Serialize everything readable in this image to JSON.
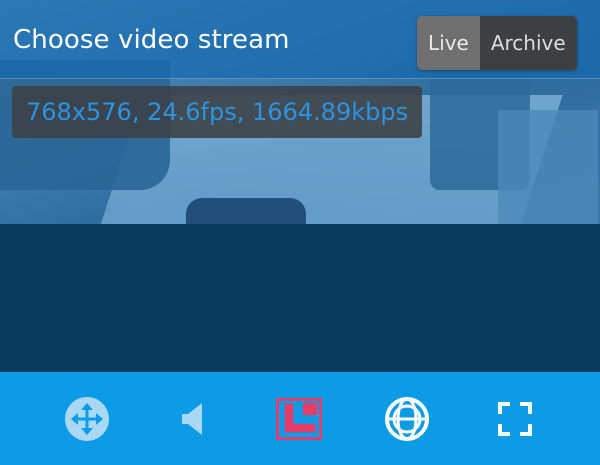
{
  "header": {
    "title": "Choose video stream",
    "modes": [
      {
        "label": "Live",
        "active": true
      },
      {
        "label": "Archive",
        "active": false
      }
    ]
  },
  "stream": {
    "info": "768x576, 24.6fps, 1664.89kbps"
  },
  "toolbar": {
    "items": [
      {
        "icon": "ptz-move-icon",
        "active": false
      },
      {
        "icon": "speaker-icon",
        "active": false
      },
      {
        "icon": "layout-icon",
        "active": true
      },
      {
        "icon": "fisheye-icon",
        "active": false
      },
      {
        "icon": "fullscreen-icon",
        "active": false
      }
    ]
  },
  "colors": {
    "toolbar_bg": "#0d9be6",
    "active_icon": "#e53d6a",
    "info_text": "#2b93df",
    "background": "#063b5e"
  }
}
